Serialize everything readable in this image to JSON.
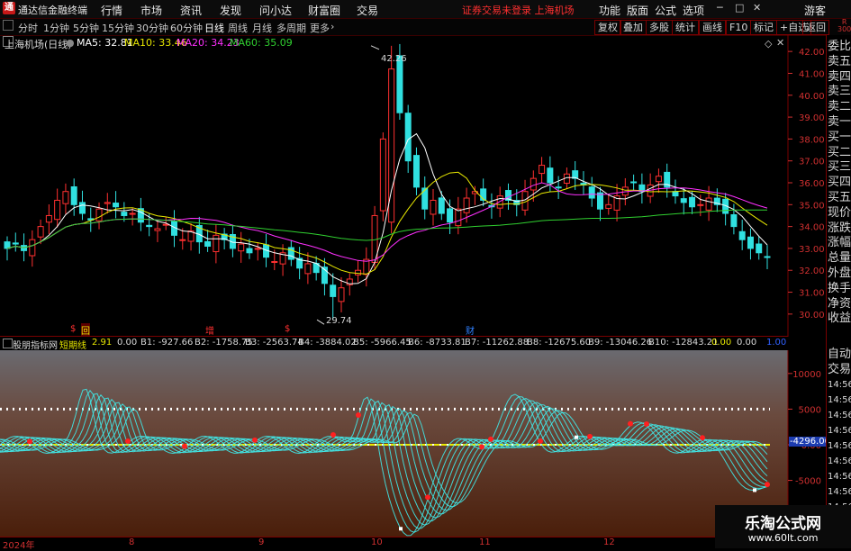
{
  "titlebar": {
    "app_title": "通达信金融终端",
    "menus": [
      "行情",
      "市场",
      "资讯",
      "发现",
      "问小达",
      "财富圈",
      "交易"
    ],
    "notice": "证券交易未登录  上海机场",
    "right_menus": [
      "功能",
      "版面",
      "公式",
      "选项"
    ],
    "user": "游客"
  },
  "toolbar": {
    "periods": [
      "分时",
      "1分钟",
      "5分钟",
      "15分钟",
      "30分钟",
      "60分钟",
      "日线",
      "周线",
      "月线",
      "多周期",
      "更多"
    ],
    "active_period": "日线",
    "right_buttons": [
      "复权",
      "叠加",
      "多股",
      "统计",
      "画线",
      "F10",
      "标记",
      "+自选",
      "返回"
    ]
  },
  "main_chart": {
    "stock_label": "上海机场(日线)",
    "ma": [
      {
        "label": "MA5: 32.81",
        "color": "#ffffff"
      },
      {
        "label": "MA10: 33.46",
        "color": "#e8e800"
      },
      {
        "label": "MA20: 34.23",
        "color": "#ff30ff"
      },
      {
        "label": "MA60: 35.09",
        "color": "#30d030"
      }
    ],
    "price_ticks": [
      "42.00",
      "41.00",
      "40.00",
      "39.00",
      "38.00",
      "37.00",
      "36.00",
      "35.00",
      "34.00",
      "33.00",
      "32.00",
      "31.00",
      "30.00"
    ],
    "high_label": "42.26",
    "low_label": "29.74",
    "event_marks": [
      {
        "text": "$",
        "color": "#ff3030"
      },
      {
        "text": "回",
        "color": "#e8e800"
      },
      {
        "text": "增",
        "color": "#ff3030"
      },
      {
        "text": "$",
        "color": "#ff3030"
      },
      {
        "text": "财",
        "color": "#3080ff"
      }
    ]
  },
  "indicator": {
    "name": "股朋指标网",
    "line_name": "短期线",
    "values": [
      "2.91",
      "0.00",
      "B1: -927.66",
      "B2: -1758.75",
      "B3: -2563.74",
      "B4: -3884.02",
      "B5: -5966.45",
      "B6: -8733.81",
      "B7: -11262.88",
      "B8: -12675.60",
      "B9: -13046.26",
      "B10: -12843.21",
      "0.00",
      "0.00"
    ],
    "right_value": "1.00",
    "ticks": [
      "10000",
      "5000",
      "0.00",
      "-5000",
      "-10000"
    ],
    "current_value": "-4296.00"
  },
  "side_panel": {
    "items": [
      "委比",
      "卖五",
      "卖四",
      "卖三",
      "卖二",
      "卖一",
      "买一",
      "买二",
      "买三",
      "买四",
      "买五",
      "现价",
      "涨跌",
      "涨幅",
      "总量",
      "外盘",
      "换手",
      "净资",
      "收益"
    ],
    "top_mini": "R\n300",
    "lower_items": [
      "自动",
      "交易"
    ],
    "times": [
      "14:56",
      "14:56",
      "14:56",
      "14:56",
      "14:56",
      "14:56",
      "14:56",
      "14:56",
      "14:56",
      "14:56"
    ]
  },
  "xaxis": {
    "labels": [
      "2024年",
      "8",
      "9",
      "10",
      "11",
      "12"
    ]
  },
  "brand": {
    "name": "乐淘公式网",
    "url": "www.60lt.com"
  },
  "chart_data": {
    "type": "candlestick",
    "title": "上海机场(日线)",
    "ylim": [
      29.5,
      42.5
    ],
    "x_labels": [
      "2024年",
      "8",
      "9",
      "10",
      "11",
      "12"
    ],
    "series_note": "daily OHLC approximated",
    "closes": [
      33.0,
      33.2,
      32.9,
      33.4,
      34.0,
      34.5,
      35.2,
      35.6,
      35.0,
      34.6,
      34.3,
      34.8,
      35.1,
      34.9,
      34.5,
      34.6,
      34.2,
      34.0,
      33.9,
      34.1,
      33.6,
      33.4,
      33.8,
      33.3,
      33.1,
      33.6,
      33.4,
      33.0,
      33.2,
      32.8,
      33.0,
      32.6,
      32.4,
      32.8,
      32.5,
      32.1,
      32.3,
      31.9,
      31.4,
      30.8,
      31.2,
      31.6,
      32.0,
      32.5,
      34.5,
      38.0,
      41.2,
      39.2,
      37.0,
      35.8,
      34.8,
      35.2,
      34.6,
      34.2,
      34.8,
      35.3,
      35.6,
      35.2,
      34.9,
      35.4,
      35.2,
      35.0,
      35.6,
      36.2,
      36.8,
      36.0,
      35.8,
      36.4,
      36.2,
      35.9,
      35.3,
      34.8,
      35.0,
      35.4,
      35.8,
      36.0,
      35.6,
      35.9,
      36.3,
      35.8,
      35.4,
      35.1,
      34.9,
      35.0,
      35.3,
      35.0,
      34.6,
      34.0,
      33.4,
      33.0,
      32.8,
      32.6
    ]
  }
}
